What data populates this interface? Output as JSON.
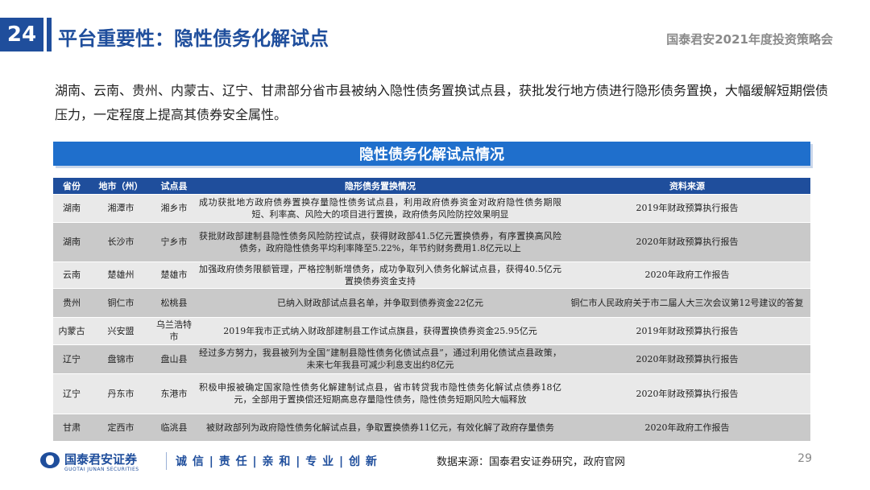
{
  "header": {
    "page_number": "24",
    "title": "平台重要性：隐性债务化解试点",
    "right_label": "国泰君安2021年度投资策略会"
  },
  "intro": "湖南、云南、贵州、内蒙古、辽宁、甘肃部分省市县被纳入隐性债务置换试点县，获批发行地方债进行隐形债务置换，大幅缓解短期偿债压力，一定程度上提高其债券安全属性。",
  "table": {
    "title": "隐性债务化解试点情况",
    "columns": [
      "省份",
      "地市（州）",
      "试点县",
      "隐形债务置换情况",
      "资料来源"
    ],
    "rows": [
      [
        "湖南",
        "湘潭市",
        "湘乡市",
        "成功获批地方政府债券置换存量隐性债务试点县，利用政府债券资金对政府隐性债务期限短、利率高、风险大的项目进行置换，政府债务风险防控效果明显",
        "2019年财政预算执行报告"
      ],
      [
        "湖南",
        "长沙市",
        "宁乡市",
        "获批财政部建制县隐性债务风险防控试点，获得财政部41.5亿元置换债券，有序置换高风险债务，政府隐性债务平均利率降至5.22%，年节约财务费用1.8亿元以上",
        "2020年财政预算执行报告"
      ],
      [
        "云南",
        "楚雄州",
        "楚雄市",
        "加强政府债务限额管理，严格控制新增债务，成功争取列入债务化解试点县，获得40.5亿元置换债券资金支持",
        "2020年政府工作报告"
      ],
      [
        "贵州",
        "铜仁市",
        "松桃县",
        "已纳入财政部试点县名单，并争取到债券资金22亿元",
        "铜仁市人民政府关于市二届人大三次会议第12号建议的答复"
      ],
      [
        "内蒙古",
        "兴安盟",
        "乌兰浩特市",
        "2019年我市正式纳入财政部建制县工作试点旗县，获得置换债券资金25.95亿元",
        "2019年财政预算执行报告"
      ],
      [
        "辽宁",
        "盘锦市",
        "盘山县",
        "经过多方努力，我县被列为全国“建制县隐性债务化债试点县”，通过利用化债试点县政策，未来七年我县可减少利息支出约8亿元",
        "2020年财政预算执行报告"
      ],
      [
        "辽宁",
        "丹东市",
        "东港市",
        "积极申报被确定国家隐性债务化解建制试点县，省市转贷我市隐性债务化解试点债券18亿元，全部用于置换偿还短期高息存量隐性债务，隐性债务短期风险大幅释放",
        "2020年财政预算执行报告"
      ],
      [
        "甘肃",
        "定西市",
        "临洮县",
        "被财政部列为政府隐性债务化解试点县，争取置换债券11亿元，有效化解了政府存量债务",
        "2020年政府工作报告"
      ]
    ]
  },
  "footer": {
    "brand": "国泰君安证券",
    "brand_en": "GUOTAI JUNAN SECURITIES",
    "slogan": "诚 信 | 责 任 | 亲 和 | 专 业 | 创 新",
    "source": "数据来源：国泰君安证券研究，政府官网",
    "page": "29"
  },
  "colors": {
    "brand_blue": "#1f4e9c",
    "table_title_blue": "#1f6fcc",
    "row_light": "#e9e9e9",
    "row_dark": "#c9c9c9"
  }
}
